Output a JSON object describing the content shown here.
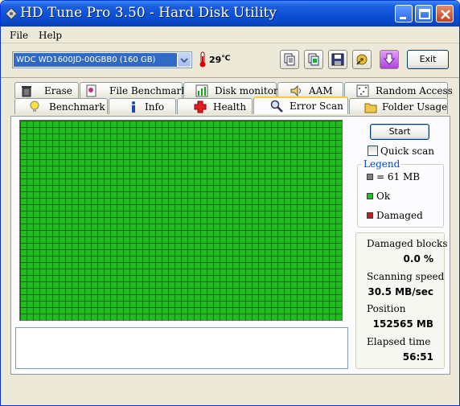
{
  "window": {
    "title": "HD Tune Pro 3.50 - Hard Disk Utility"
  },
  "menu": {
    "file": "File",
    "help": "Help"
  },
  "toolbar": {
    "drive": "WDC WD1600JD-00GBB0 (160 GB)",
    "temperature": "29",
    "exit_label": "Exit",
    "buttons": [
      "copy-info-icon",
      "copy-screenshot-icon",
      "save-icon",
      "options-icon",
      "download-icon"
    ]
  },
  "tabs": {
    "top": [
      "Erase",
      "File Benchmark",
      "Disk monitor",
      "AAM",
      "Random Access"
    ],
    "bottom": [
      "Benchmark",
      "Info",
      "Health",
      "Error Scan",
      "Folder Usage"
    ],
    "active": "Error Scan"
  },
  "scan": {
    "start_label": "Start",
    "quick_scan_label": "Quick scan",
    "quick_scan_checked": false,
    "block_color_ok": "#20bb20",
    "block_status": "Ok"
  },
  "legend": {
    "title": "Legend",
    "block_size": "= 61 MB",
    "ok": "Ok",
    "damaged": "Damaged",
    "colors": {
      "block": "#808080",
      "ok": "#20c020",
      "damaged": "#c02020"
    }
  },
  "stats": {
    "damaged_label": "Damaged blocks",
    "damaged_value": "0.0 %",
    "speed_label": "Scanning speed",
    "speed_value": "30.5 MB/sec",
    "position_label": "Position",
    "position_value": "152565 MB",
    "elapsed_label": "Elapsed time",
    "elapsed_value": "56:51"
  }
}
